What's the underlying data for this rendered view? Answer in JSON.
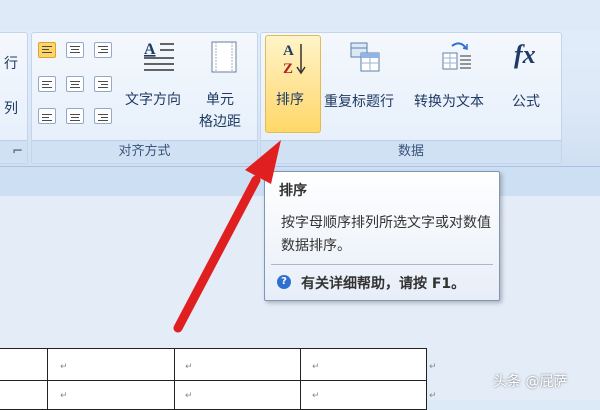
{
  "ribbon": {
    "left_group": {
      "partial_top": "行",
      "partial_mid": "列"
    },
    "alignment_group": {
      "label": "对齐方式",
      "text_direction_label": "文字方向",
      "cell_margins_label_line1": "单元",
      "cell_margins_label_line2": "格边距"
    },
    "data_group": {
      "label": "数据",
      "sort_label": "排序",
      "repeat_header_label": "重复标题行",
      "convert_to_text_label": "转换为文本",
      "formula_label": "公式",
      "formula_icon_text": "fx",
      "sort_icon_a": "A",
      "sort_icon_z": "Z"
    }
  },
  "tooltip": {
    "title": "排序",
    "body": "按字母顺序排列所选文字或对数值数据排序。",
    "help": "有关详细帮助，请按 F1。",
    "help_icon_text": "?"
  },
  "table": {
    "paragraph_mark": "↵"
  },
  "watermark": "头条 @屁萨",
  "colors": {
    "ribbon_text": "#1f3a63",
    "highlight": "#ffd867",
    "arrow": "#e02020"
  }
}
